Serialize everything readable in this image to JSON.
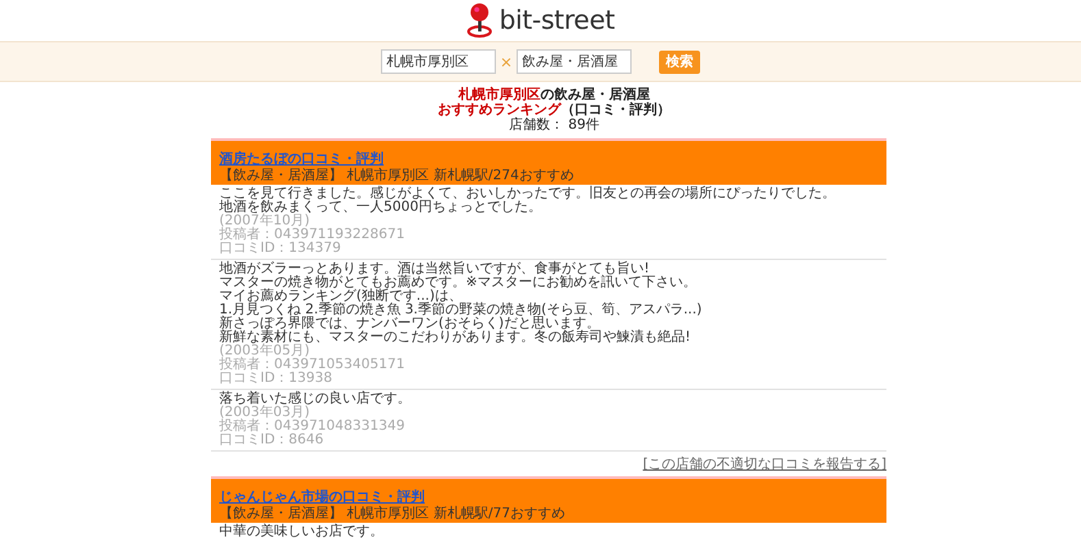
{
  "logo": {
    "text": "bit-street"
  },
  "search": {
    "area": "札幌市厚別区",
    "separator": "×",
    "genre": "飲み屋・居酒屋",
    "button": "検索"
  },
  "heading": {
    "area": "札幌市厚別区",
    "title": "の飲み屋・居酒屋",
    "subtitle": "おすすめランキング",
    "suffix": "（口コミ・評判）",
    "count": "店舗数： 89件"
  },
  "shops": [
    {
      "title": "酒房たるぼの口コミ・評判",
      "info": "【飲み屋・居酒屋】 札幌市厚別区 新札幌駅/274おすすめ",
      "reviews": [
        {
          "lines": [
            "ここを見て行きました。感じがよくて、おいしかったです。旧友との再会の場所にぴったりでした。",
            "地酒を飲みまくって、一人5000円ちょっとでした。"
          ],
          "date": "(2007年10月)",
          "poster": "投稿者：043971193228671",
          "review_id": "口コミID：134379"
        },
        {
          "lines": [
            "地酒がズラーっとあります。酒は当然旨いですが、食事がとても旨い!",
            "マスターの焼き物がとてもお薦めです。※マスターにお勧めを訊いて下さい。",
            "マイお薦めランキング(独断です...)は、",
            "1.月見つくね 2.季節の焼き魚 3.季節の野菜の焼き物(そら豆、筍、アスパラ...)",
            "新さっぽろ界隈では、ナンバーワン(おそらく)だと思います。",
            "新鮮な素材にも、マスターのこだわりがあります。冬の飯寿司や鰊漬も絶品!"
          ],
          "date": "(2003年05月)",
          "poster": "投稿者：043971053405171",
          "review_id": "口コミID：13938"
        },
        {
          "lines": [
            "落ち着いた感じの良い店です。"
          ],
          "date": "(2003年03月)",
          "poster": "投稿者：043971048331349",
          "review_id": "口コミID：8646"
        }
      ],
      "report_link": "[この店舗の不適切な口コミを報告する]"
    },
    {
      "title": "じゃんじゃん市場の口コミ・評判",
      "info": "【飲み屋・居酒屋】 札幌市厚別区 新札幌駅/77おすすめ",
      "reviews": [
        {
          "lines": [
            "中華の美味しいお店です。"
          ]
        }
      ]
    }
  ]
}
